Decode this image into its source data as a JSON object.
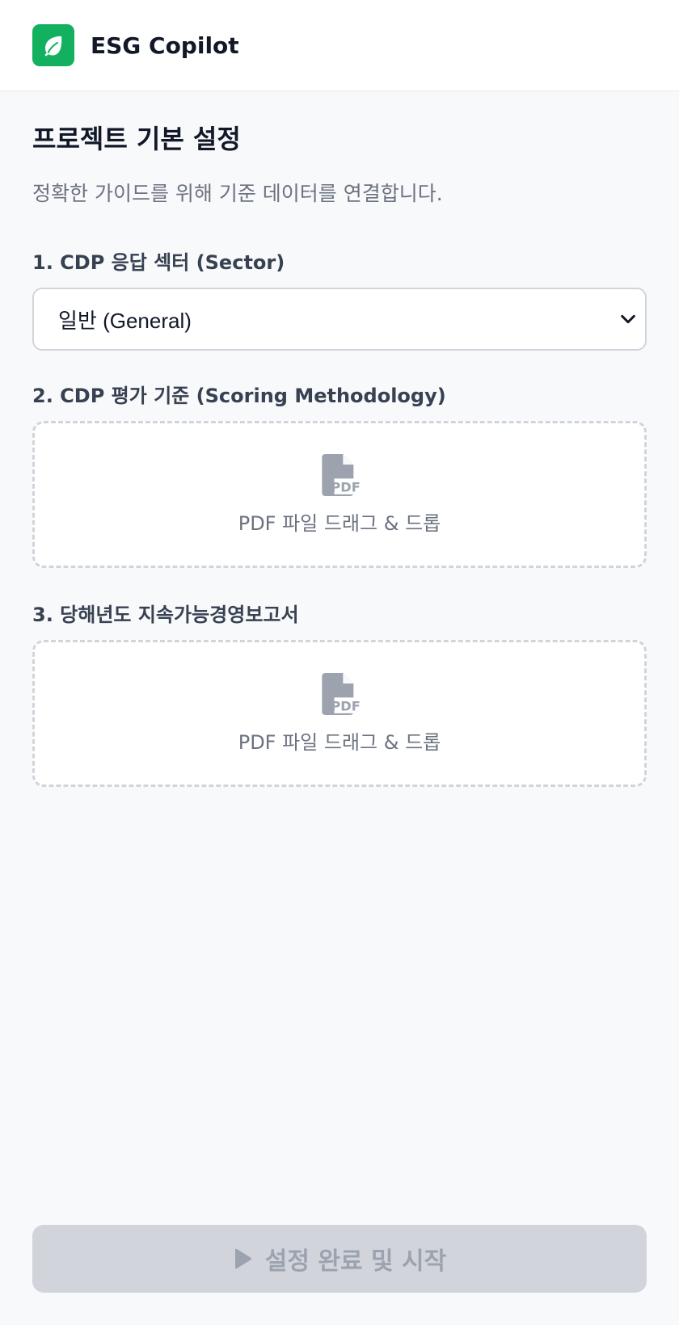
{
  "header": {
    "title": "ESG Copilot",
    "logo_icon": "leaf-icon",
    "brand_color": "#12b05f"
  },
  "page": {
    "title": "프로젝트 기본 설정",
    "subtitle": "정확한 가이드를 위해 기준 데이터를 연결합니다."
  },
  "fields": {
    "sector": {
      "label": "1. CDP 응답 섹터 (Sector)",
      "selected": "일반 (General)"
    },
    "scoring": {
      "label": "2. CDP 평가 기준 (Scoring Methodology)",
      "drop_text": "PDF 파일 드래그 & 드롭",
      "icon": "pdf-file-icon"
    },
    "report": {
      "label": "3. 당해년도 지속가능경영보고서",
      "drop_text": "PDF 파일 드래그 & 드롭",
      "icon": "pdf-file-icon"
    }
  },
  "footer": {
    "start_label": "설정 완료 및 시작",
    "start_icon": "play-icon",
    "disabled": true
  }
}
